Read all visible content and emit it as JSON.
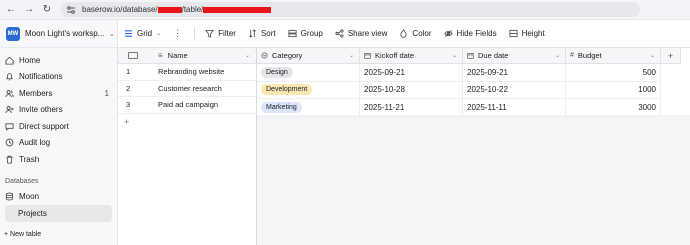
{
  "browser": {
    "url_prefix": "baserow.io/database/",
    "url_mid": "/table/"
  },
  "workspace": {
    "badge": "MW",
    "name": "Moon Light's worksp..."
  },
  "sidebar": {
    "items": [
      {
        "label": "Home",
        "icon": "home-icon"
      },
      {
        "label": "Notifications",
        "icon": "bell-icon"
      },
      {
        "label": "Members",
        "icon": "users-icon",
        "count": "1"
      },
      {
        "label": "Invite others",
        "icon": "user-plus-icon"
      },
      {
        "label": "Direct support",
        "icon": "chat-icon"
      },
      {
        "label": "Audit log",
        "icon": "clock-icon"
      },
      {
        "label": "Trash",
        "icon": "trash-icon"
      }
    ],
    "section_label": "Databases",
    "database": "Moon",
    "table": "Projects",
    "new_table": "+ New table"
  },
  "toolbar": {
    "view": "Grid",
    "filter": "Filter",
    "sort": "Sort",
    "group": "Group",
    "share": "Share view",
    "color": "Color",
    "hide": "Hide Fields",
    "height": "Height"
  },
  "grid": {
    "columns": {
      "name": "Name",
      "category": "Category",
      "kickoff": "Kickoff date",
      "due": "Due date",
      "budget": "Budget"
    },
    "rows": [
      {
        "id": "1",
        "name": "Rebranding website",
        "category": "Design",
        "kickoff": "2025-09-21",
        "due": "2025-09-21",
        "budget": "500"
      },
      {
        "id": "2",
        "name": "Customer research",
        "category": "Development",
        "kickoff": "2025-10-28",
        "due": "2025-10-22",
        "budget": "1000"
      },
      {
        "id": "3",
        "name": "Paid ad campaign",
        "category": "Marketing",
        "kickoff": "2025-11-21",
        "due": "2025-11-11",
        "budget": "3000"
      }
    ],
    "add_row": "+",
    "add_col": "+"
  },
  "colors": {
    "design_badge": "#e3e5e8",
    "development_badge": "#fde8b4",
    "marketing_badge": "#dbe6fb",
    "workspace_badge": "#2a6bd5",
    "redaction": "#e8161b"
  }
}
